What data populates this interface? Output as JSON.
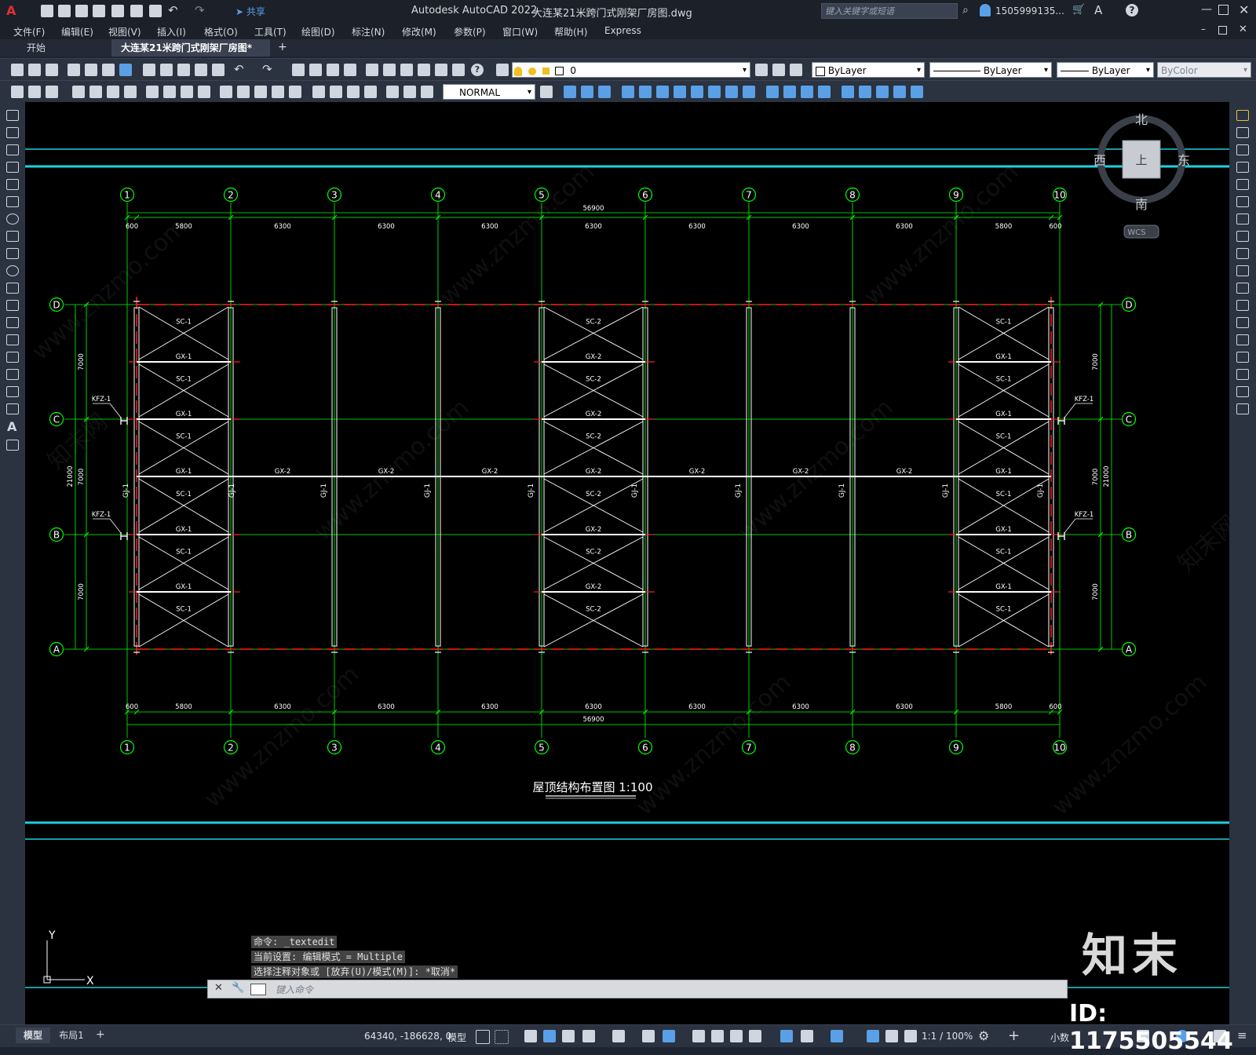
{
  "window": {
    "app_title": "Autodesk AutoCAD 2022",
    "doc_title": "大连某21米跨门式刚架厂房图.dwg",
    "search_placeholder": "键入关键字或短语",
    "user": "1505999135...",
    "share": "共享"
  },
  "menu": [
    "文件(F)",
    "编辑(E)",
    "视图(V)",
    "插入(I)",
    "格式(O)",
    "工具(T)",
    "绘图(D)",
    "标注(N)",
    "修改(M)",
    "参数(P)",
    "窗口(W)",
    "帮助(H)",
    "Express"
  ],
  "tabs": {
    "start": "开始",
    "active": "大连某21米跨门式刚架厂房图*",
    "add": "+"
  },
  "properties": {
    "layer": "0",
    "color": "ByLayer",
    "linetype": "ByLayer",
    "lineweight": "ByLayer",
    "plotstyle": "ByColor",
    "dimstyle": "NORMAL"
  },
  "viewcube": {
    "north": "北",
    "south": "南",
    "east": "东",
    "west": "西",
    "top": "上",
    "wcs": "WCS"
  },
  "drawing": {
    "axes_numbers": [
      "1",
      "2",
      "3",
      "4",
      "5",
      "6",
      "7",
      "8",
      "9",
      "10"
    ],
    "axes_letters": [
      "D",
      "C",
      "B",
      "A"
    ],
    "dims_x": [
      "600",
      "5800",
      "6300",
      "6300",
      "6300",
      "6300",
      "6300",
      "6300",
      "6300",
      "5800",
      "600"
    ],
    "total_x": "56900",
    "dims_y": [
      "7000",
      "7000",
      "7000"
    ],
    "total_y": "21000",
    "title": "屋顶结构布置图 1:100",
    "labels": {
      "sc1": "SC-1",
      "sc2": "SC-2",
      "gx1": "GX-1",
      "gx2": "GX-2",
      "gj1": "GJ-1",
      "kfz1": "KFZ-1"
    },
    "ucs_x": "X",
    "ucs_y": "Y"
  },
  "watermark": {
    "logo": "知末",
    "id": "ID: 1175505544",
    "site": "www.znzmo.com",
    "site_cn": "知末网"
  },
  "command": {
    "history": [
      "命令: _textedit",
      "当前设置: 编辑模式 = Multiple",
      "选择注释对象或 [放弃(U)/模式(M)]: *取消*"
    ],
    "placeholder": "键入命令"
  },
  "status": {
    "model_tab": "模型",
    "layout_tab": "布局1",
    "coords": "64340, -186628, 0",
    "model": "模型",
    "scale": "1:1 / 100%",
    "units": "小数"
  }
}
